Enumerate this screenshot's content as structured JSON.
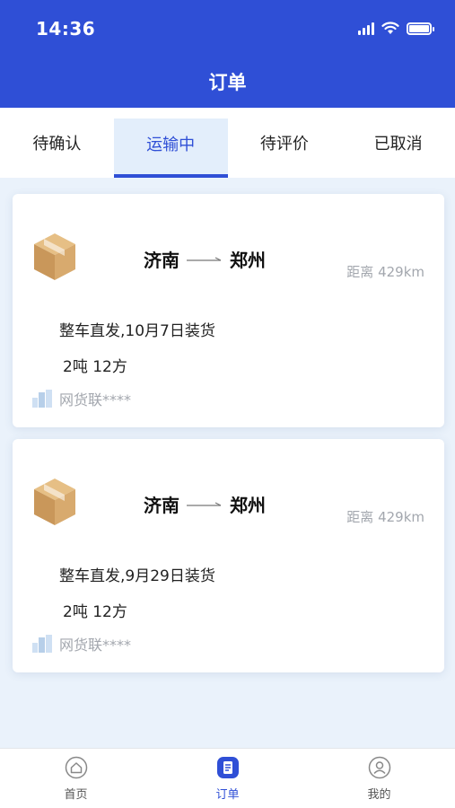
{
  "status": {
    "time": "14:36"
  },
  "header": {
    "title": "订单"
  },
  "tabs": [
    {
      "label": "待确认",
      "active": false
    },
    {
      "label": "运输中",
      "active": true
    },
    {
      "label": "待评价",
      "active": false
    },
    {
      "label": "已取消",
      "active": false
    }
  ],
  "orders": [
    {
      "from": "济南",
      "to": "郑州",
      "distance": "距离 429km",
      "detail": "整车直发,10月7日装货",
      "load": "2吨 12方",
      "company": "网货联****"
    },
    {
      "from": "济南",
      "to": "郑州",
      "distance": "距离 429km",
      "detail": "整车直发,9月29日装货",
      "load": "2吨 12方",
      "company": "网货联****"
    }
  ],
  "bottom_nav": [
    {
      "label": "首页",
      "icon": "home-icon",
      "active": false
    },
    {
      "label": "订单",
      "icon": "order-icon",
      "active": true
    },
    {
      "label": "我的",
      "icon": "profile-icon",
      "active": false
    }
  ],
  "colors": {
    "primary": "#2f4fd6",
    "box": "#d4a76a",
    "muted": "#a3a7ae"
  }
}
